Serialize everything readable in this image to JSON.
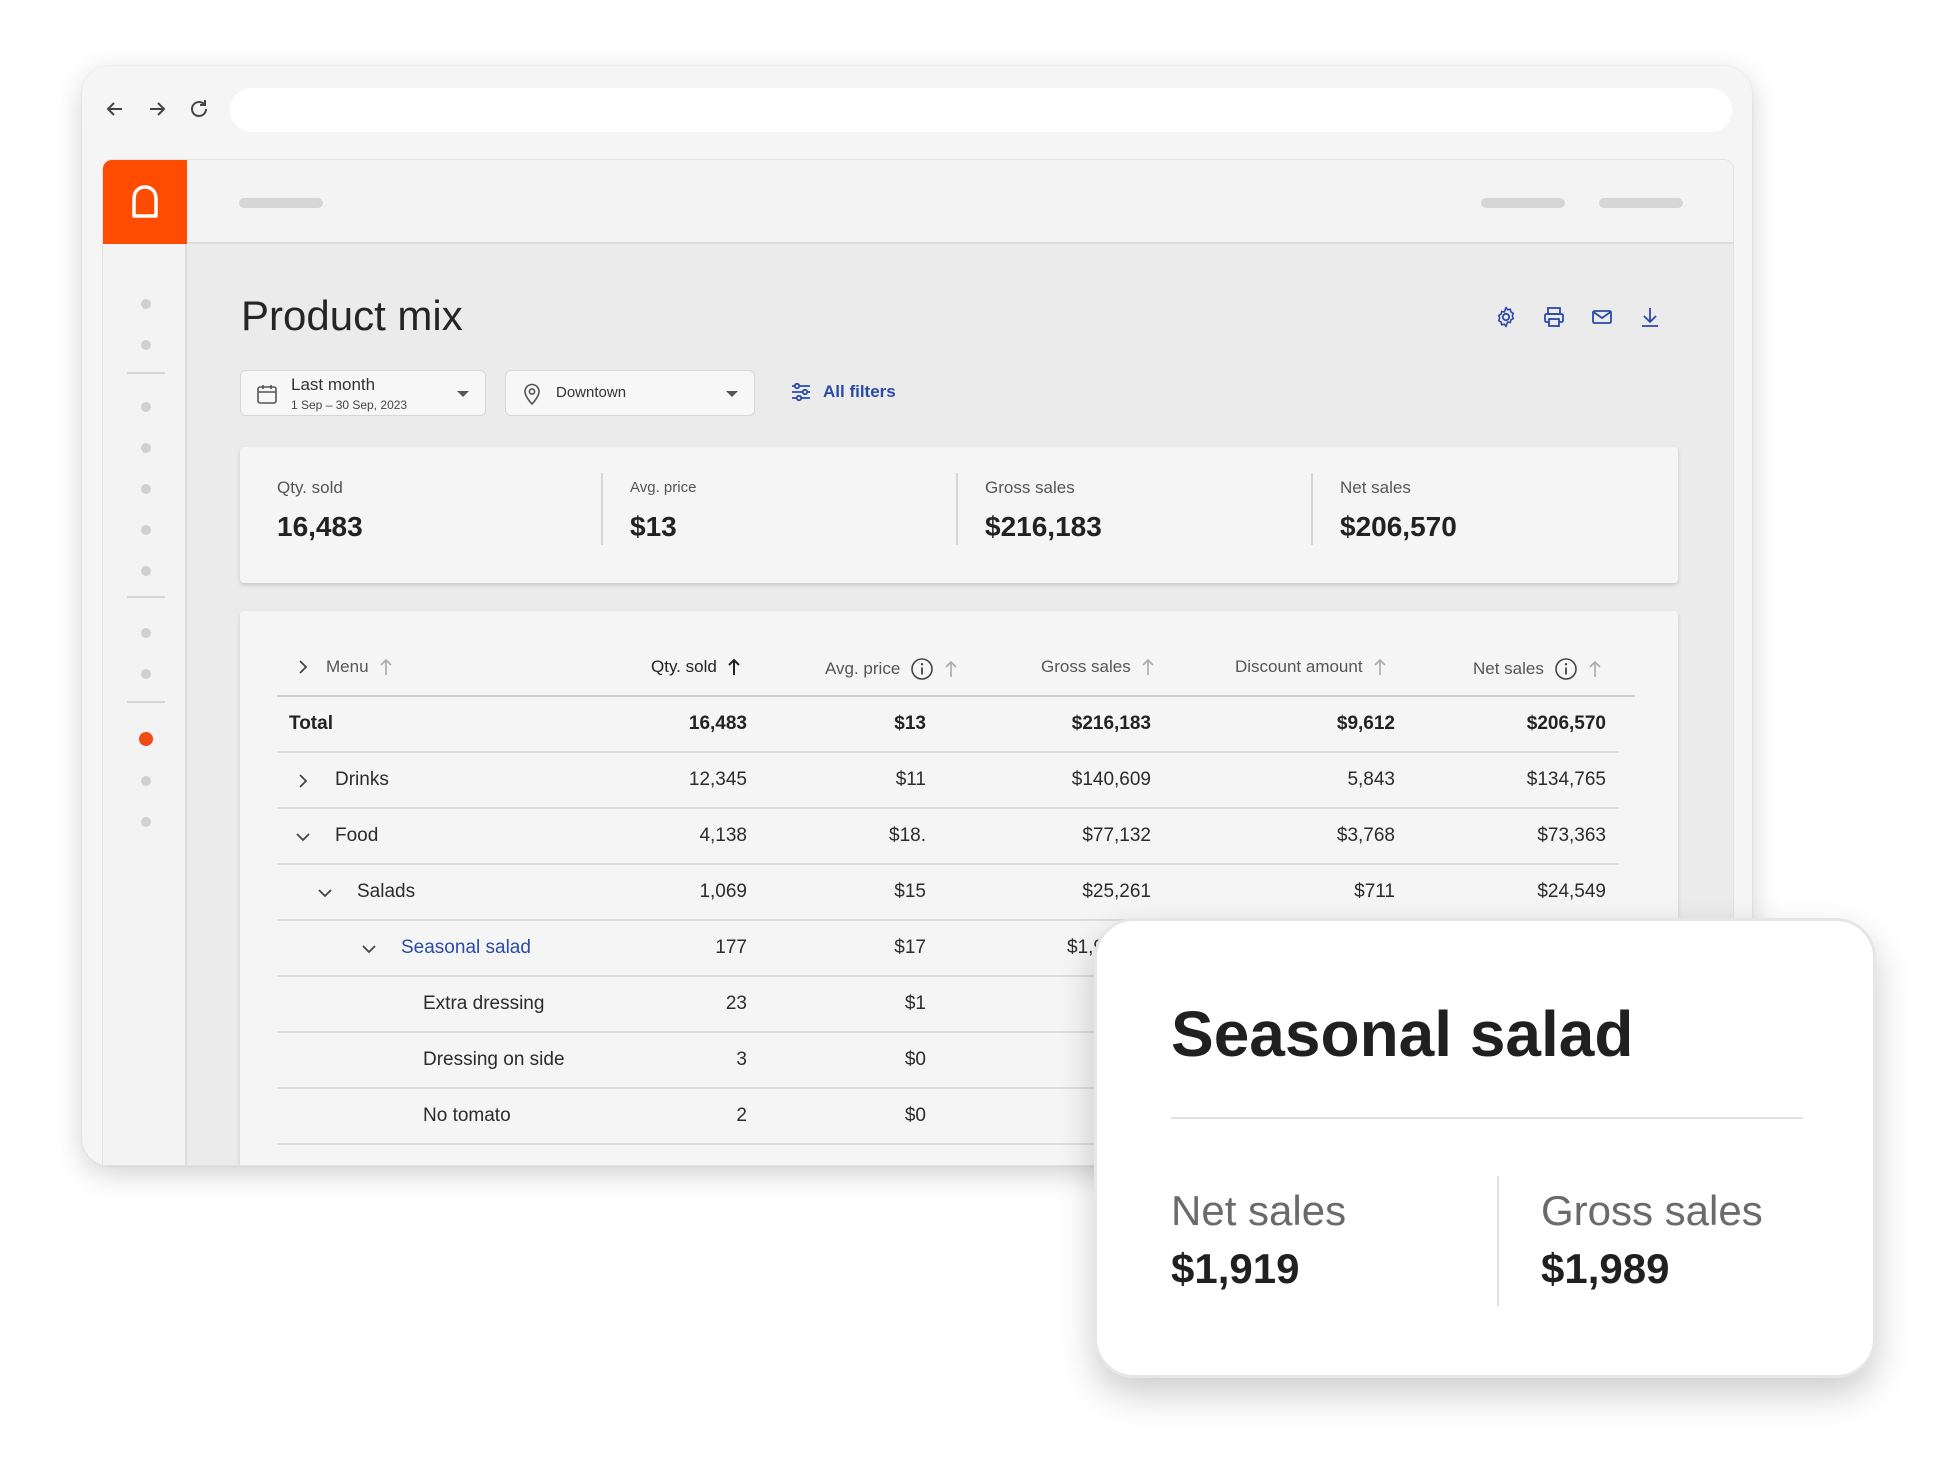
{
  "page": {
    "title": "Product mix"
  },
  "filters": {
    "date_label": "Last month",
    "date_range": "1 Sep – 30 Sep, 2023",
    "location": "Downtown",
    "all_filters": "All filters"
  },
  "kpis": [
    {
      "label": "Qty. sold",
      "value": "16,483"
    },
    {
      "label": "Avg. price",
      "value": "$13"
    },
    {
      "label": "Gross sales",
      "value": "$216,183"
    },
    {
      "label": "Net sales",
      "value": "$206,570"
    }
  ],
  "table": {
    "headers": {
      "menu": "Menu",
      "qty": "Qty. sold",
      "avg": "Avg. price",
      "gross": "Gross sales",
      "discount": "Discount amount",
      "net": "Net sales"
    },
    "rows": [
      {
        "name": "Total",
        "qty": "16,483",
        "avg": "$13",
        "gross": "$216,183",
        "discount": "$9,612",
        "net": "$206,570"
      },
      {
        "name": "Drinks",
        "qty": "12,345",
        "avg": "$11",
        "gross": "$140,609",
        "discount": "5,843",
        "net": "$134,765"
      },
      {
        "name": "Food",
        "qty": "4,138",
        "avg": "$18.",
        "gross": "$77,132",
        "discount": "$3,768",
        "net": "$73,363"
      },
      {
        "name": "Salads",
        "qty": "1,069",
        "avg": "$15",
        "gross": "$25,261",
        "discount": "$711",
        "net": "$24,549"
      },
      {
        "name": "Seasonal salad",
        "qty": "177",
        "avg": "$17",
        "gross": "$1,9",
        "discount": "",
        "net": ""
      },
      {
        "name": "Extra dressing",
        "qty": "23",
        "avg": "$1",
        "gross": "",
        "discount": "",
        "net": ""
      },
      {
        "name": "Dressing on side",
        "qty": "3",
        "avg": "$0",
        "gross": "",
        "discount": "",
        "net": ""
      },
      {
        "name": "No tomato",
        "qty": "2",
        "avg": "$0",
        "gross": "",
        "discount": "",
        "net": ""
      }
    ]
  },
  "popup": {
    "title": "Seasonal salad",
    "net_label": "Net sales",
    "net_value": "$1,919",
    "gross_label": "Gross sales",
    "gross_value": "$1,989"
  },
  "colors": {
    "brand": "#ff4c00",
    "link": "#2a4aa8",
    "active_nav": "#f04b14"
  },
  "icons": [
    "back-arrow-icon",
    "forward-arrow-icon",
    "reload-icon",
    "logo-icon",
    "settings-icon",
    "print-icon",
    "mail-icon",
    "download-icon",
    "calendar-icon",
    "location-pin-icon",
    "filter-sliders-icon",
    "info-icon",
    "sort-arrow-icon",
    "chevron-right-icon",
    "chevron-down-icon"
  ]
}
